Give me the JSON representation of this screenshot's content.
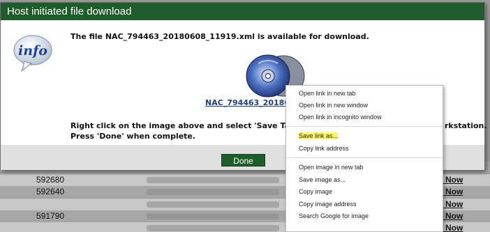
{
  "background_table": {
    "rows": [
      {
        "id": "",
        "link": ""
      },
      {
        "id": "592680",
        "link": "r Now"
      },
      {
        "id": "592640",
        "link": "r Now"
      },
      {
        "id": "",
        "link": "r Now"
      },
      {
        "id": "591790",
        "link": "r Now"
      },
      {
        "id": "",
        "link": "r Now"
      }
    ]
  },
  "dialog": {
    "title": "Host initiated file download",
    "message": "The file NAC_794463_20180608_11919.xml is available for download.",
    "file_link": "NAC_794463_20180",
    "instruction_line1": "Right click on the image above and select 'Save Targe",
    "instruction_line1_end": "rkstation.",
    "instruction_line2": "Press 'Done' when complete.",
    "done_label": "Done",
    "info_icon": "info-icon",
    "disc_icon": "disc-icon"
  },
  "context_menu": {
    "items": [
      {
        "label": "Open link in new tab"
      },
      {
        "label": "Open link in new window"
      },
      {
        "label": "Open link in incognito window"
      },
      {
        "label": "Save link as..."
      },
      {
        "label": "Copy link address"
      },
      {
        "label": "Open image in new tab"
      },
      {
        "label": "Save image as..."
      },
      {
        "label": "Copy image"
      },
      {
        "label": "Copy image address"
      },
      {
        "label": "Search Google for image"
      }
    ],
    "highlighted": "Save link as..."
  },
  "colors": {
    "title_bar": "#1e5c2c",
    "highlight": "#fff568",
    "link": "#1f3f7a"
  }
}
